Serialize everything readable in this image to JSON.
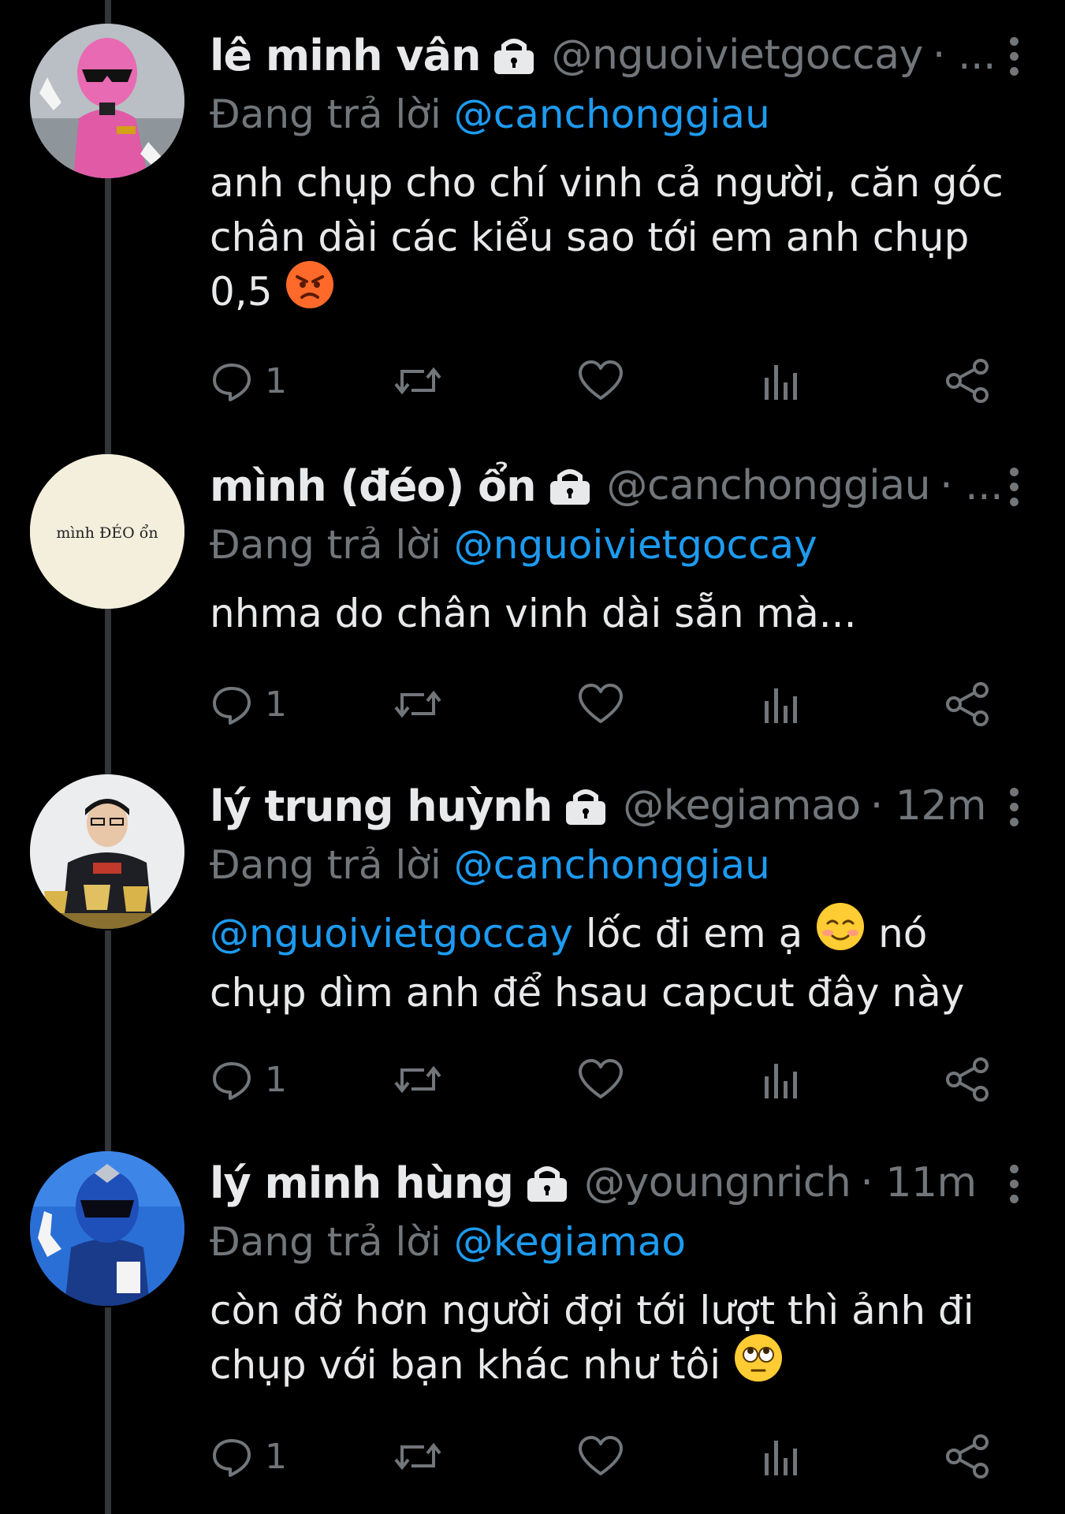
{
  "tweets": [
    {
      "name": "lê minh vân",
      "handle": "@nguoivietgoccay",
      "time": "· ...",
      "reply_label": "Đang trả lời",
      "reply_to": "@canchonggiau",
      "mention": "",
      "text_lines": [
        "anh chụp cho chí vinh cả người, căn góc",
        "chân dài các kiểu sao tới em anh chụp",
        "0,5"
      ],
      "emoji": "angry-face-emoji",
      "reply_count": "1",
      "avatar": "pink-ranger-avatar"
    },
    {
      "name": "mình (đéo) ổn",
      "handle": "@canchonggiau",
      "time": "· ...",
      "reply_label": "Đang trả lời",
      "reply_to": "@nguoivietgoccay",
      "mention": "",
      "text_lines": [
        "nhma do chân vinh dài sẵn mà..."
      ],
      "emoji": "",
      "reply_count": "1",
      "avatar_text": "mình ĐÉO ổn"
    },
    {
      "name": "lý trung huỳnh",
      "handle": "@kegiamao",
      "time": "· 12m",
      "reply_label": "Đang trả lời",
      "reply_to": "@canchonggiau",
      "mention": "@nguoivietgoccay",
      "text_lines": [
        " lốc đi em ạ",
        "chụp dìm anh để hsau capcut đây này"
      ],
      "after_emoji": " nó",
      "emoji": "smiling-face-emoji",
      "reply_count": "1",
      "avatar": "person-with-trophies-avatar"
    },
    {
      "name": "lý minh hùng",
      "handle": "@youngnrich",
      "time": "· 11m",
      "reply_label": "Đang trả lời",
      "reply_to": "@kegiamao",
      "mention": "",
      "text_lines": [
        "còn đỡ hơn người đợi tới lượt thì ảnh đi",
        "chụp với bạn khác như tôi"
      ],
      "emoji": "eye-roll-emoji",
      "reply_count": "1",
      "avatar": "blue-ranger-avatar"
    }
  ],
  "colors": {
    "background": "#000000",
    "text": "#e7e9ea",
    "muted": "#71767b",
    "link": "#1d9bf0",
    "thread_line": "#333639"
  }
}
